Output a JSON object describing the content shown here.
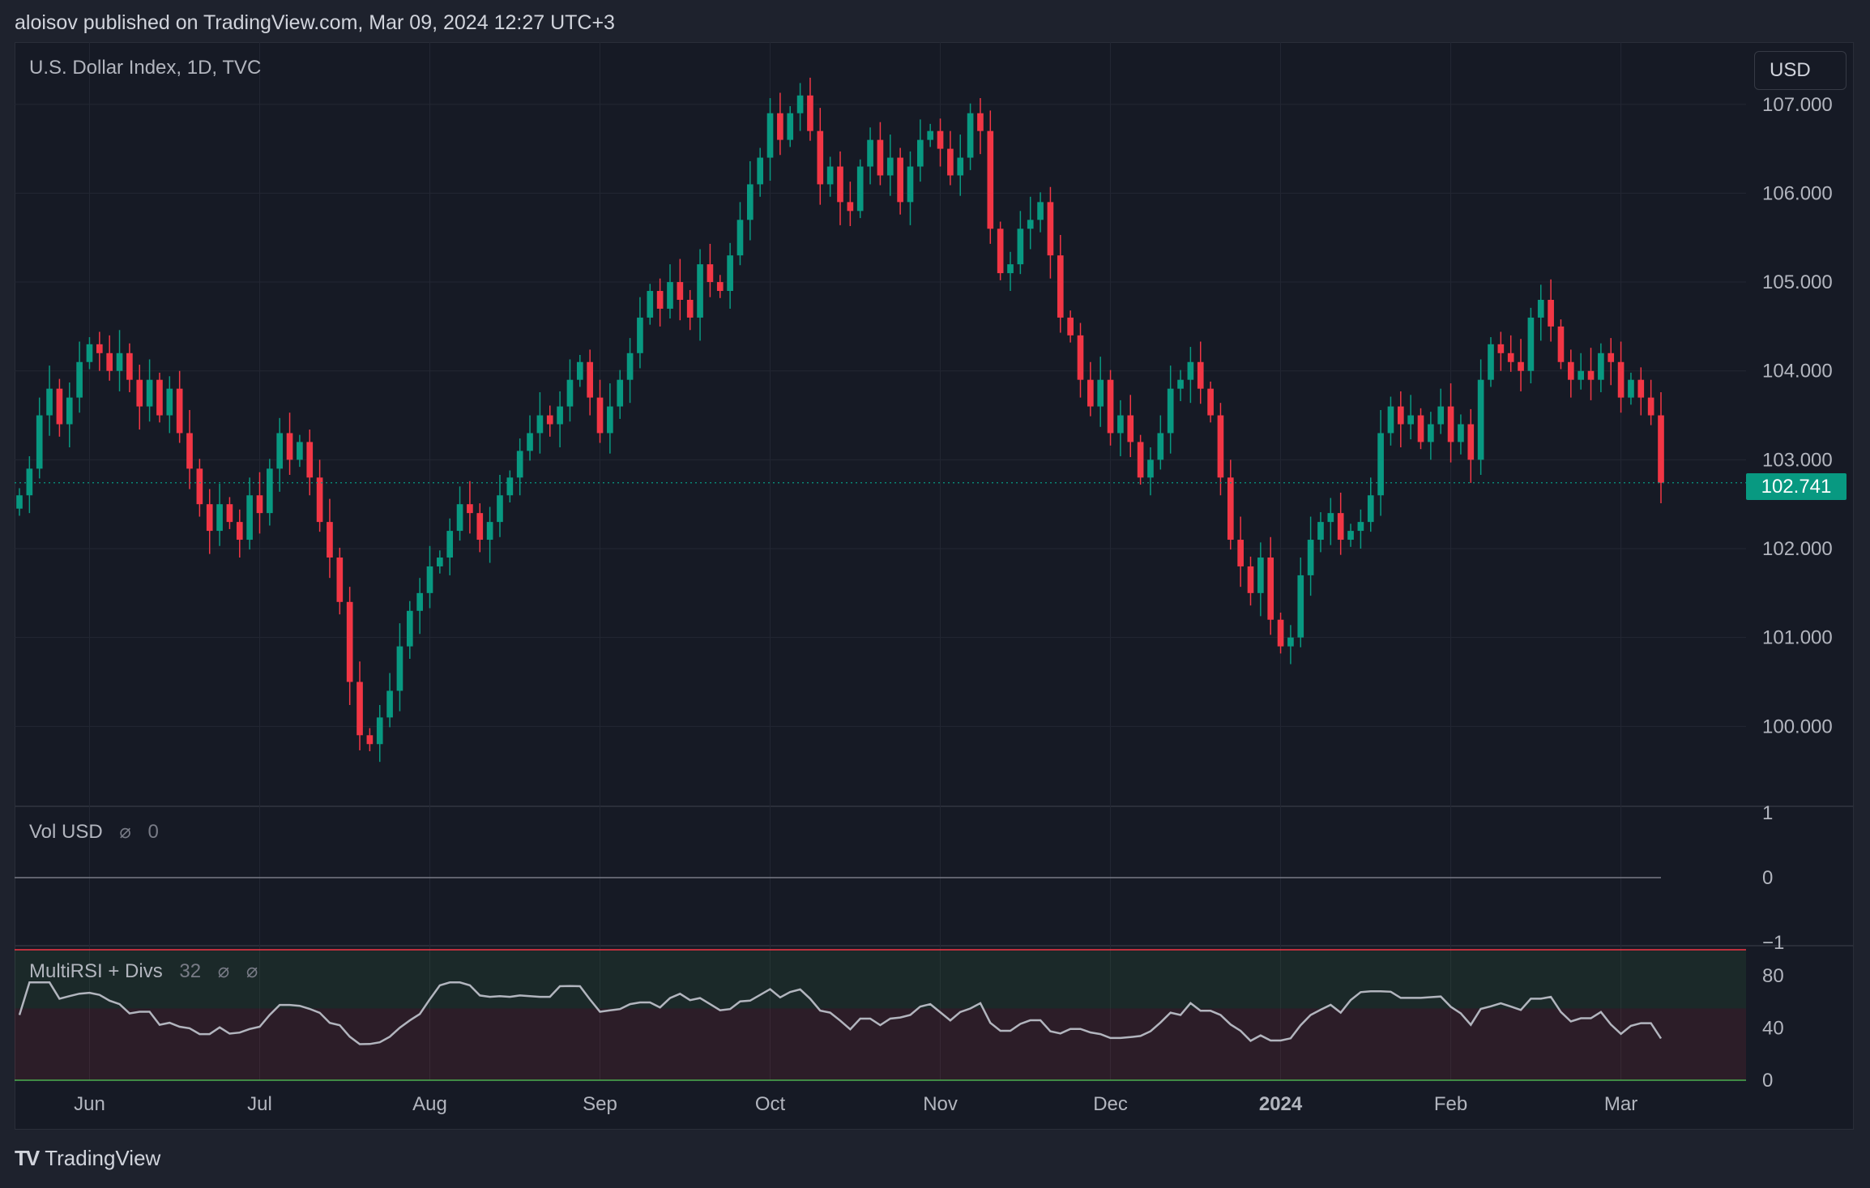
{
  "header": {
    "published_line": "aloisov published on TradingView.com, Mar 09, 2024 12:27 UTC+3"
  },
  "main_pane": {
    "title": "U.S. Dollar Index, 1D, TVC",
    "currency_label": "USD",
    "last_price": "102.741"
  },
  "volume_pane": {
    "title": "Vol USD",
    "value": "0",
    "icon": "hidden-eye-icon"
  },
  "rsi_pane": {
    "title": "MultiRSI + Divs",
    "value": "32",
    "icons": [
      "hidden-eye-icon",
      "hidden-eye-icon"
    ]
  },
  "footer": {
    "brand": "TradingView"
  },
  "colors": {
    "up": "#089981",
    "down": "#f23645",
    "background": "#161a25",
    "grid": "#232733",
    "rsi_line": "#b2b5be",
    "overbought_line": "#f23645",
    "oversold_line": "#4caf50"
  },
  "chart_data": [
    {
      "type": "candlestick",
      "title": "U.S. Dollar Index, 1D, TVC",
      "x_ticks": [
        "Jun",
        "Jul",
        "Aug",
        "Sep",
        "Oct",
        "Nov",
        "Dec",
        "2024",
        "Feb",
        "Mar"
      ],
      "y_ticks": [
        "100.000",
        "101.000",
        "102.000",
        "103.000",
        "104.000",
        "105.000",
        "106.000",
        "107.000"
      ],
      "ylim": [
        99.1,
        107.7
      ],
      "last_value": 102.741,
      "closes": [
        102.6,
        102.9,
        103.5,
        103.8,
        103.4,
        103.7,
        104.1,
        104.3,
        104.2,
        104.0,
        104.2,
        103.9,
        103.6,
        103.9,
        103.5,
        103.8,
        103.3,
        102.9,
        102.5,
        102.2,
        102.5,
        102.3,
        102.1,
        102.6,
        102.4,
        102.9,
        103.3,
        103.0,
        103.2,
        102.8,
        102.3,
        101.9,
        101.4,
        100.5,
        99.9,
        99.8,
        100.1,
        100.4,
        100.9,
        101.3,
        101.5,
        101.8,
        101.9,
        102.2,
        102.5,
        102.4,
        102.1,
        102.3,
        102.6,
        102.8,
        103.1,
        103.3,
        103.5,
        103.4,
        103.6,
        103.9,
        104.1,
        103.7,
        103.3,
        103.6,
        103.9,
        104.2,
        104.6,
        104.9,
        104.7,
        105.0,
        104.8,
        104.6,
        105.2,
        105.0,
        104.9,
        105.3,
        105.7,
        106.1,
        106.4,
        106.9,
        106.6,
        106.9,
        107.1,
        106.7,
        106.1,
        106.3,
        105.9,
        105.8,
        106.3,
        106.6,
        106.2,
        106.4,
        105.9,
        106.3,
        106.6,
        106.7,
        106.5,
        106.2,
        106.4,
        106.9,
        106.7,
        105.6,
        105.1,
        105.2,
        105.6,
        105.7,
        105.9,
        105.3,
        104.6,
        104.4,
        103.9,
        103.6,
        103.9,
        103.3,
        103.5,
        103.2,
        102.8,
        103.0,
        103.3,
        103.8,
        103.9,
        104.1,
        103.8,
        103.5,
        102.8,
        102.1,
        101.8,
        101.5,
        101.9,
        101.2,
        100.9,
        101.0,
        101.7,
        102.1,
        102.3,
        102.4,
        102.1,
        102.2,
        102.3,
        102.6,
        103.3,
        103.6,
        103.4,
        103.5,
        103.2,
        103.4,
        103.6,
        103.2,
        103.4,
        103.0,
        103.9,
        104.3,
        104.2,
        104.1,
        104.0,
        104.6,
        104.8,
        104.5,
        104.1,
        103.9,
        104.0,
        103.9,
        104.2,
        104.1,
        103.7,
        103.9,
        103.7,
        103.5,
        102.741
      ]
    },
    {
      "type": "line",
      "title": "Vol USD",
      "y_ticks": [
        "1",
        "0",
        "−1"
      ],
      "ylim": [
        -1,
        1
      ],
      "values": [
        0
      ]
    },
    {
      "type": "line",
      "title": "MultiRSI + Divs",
      "y_ticks": [
        "80",
        "40",
        "0"
      ],
      "ylim": [
        0,
        100
      ],
      "last_value": 32,
      "overbought": 100,
      "oversold": 0
    }
  ]
}
